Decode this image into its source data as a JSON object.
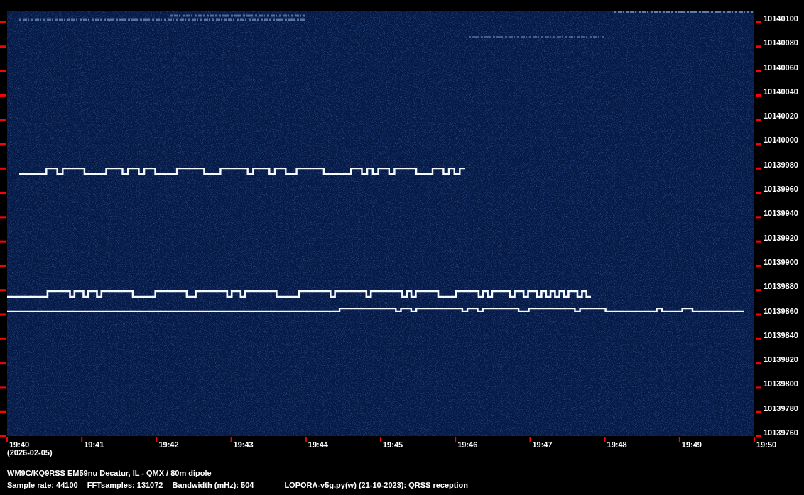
{
  "spectrogram": {
    "frequency_labels": [
      "10140100",
      "10140080",
      "10140060",
      "10140040",
      "10140020",
      "10140000",
      "10139980",
      "10139960",
      "10139940",
      "10139920",
      "10139900",
      "10139880",
      "10139860",
      "10139840",
      "10139820",
      "10139800",
      "10139780",
      "10139760"
    ],
    "time_labels": [
      "19:40",
      "19:41",
      "19:42",
      "19:43",
      "19:44",
      "19:45",
      "19:46",
      "19:47",
      "19:48",
      "19:49",
      "19:50"
    ],
    "date": "(2026-02-05)"
  },
  "footer": {
    "station": "WM9C/KQ9RSS EM59nu Decatur, IL - QMX / 80m dipole",
    "settings": [
      "Sample rate: 44100",
      "FFTsamples: 131072",
      "Bandwidth (mHz): 504"
    ],
    "software": "LOPORA-v5g.py(w) (21-10-2023): QRSS reception"
  }
}
